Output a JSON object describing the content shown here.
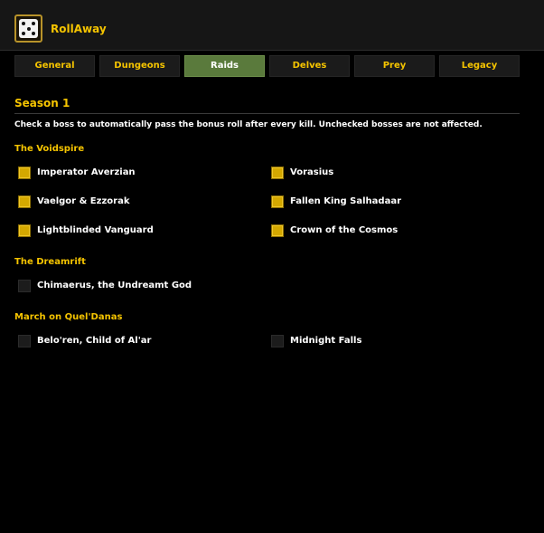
{
  "header": {
    "title": "RollAway",
    "logo_icon": "dice-five-icon"
  },
  "tabs": [
    {
      "label": "General",
      "active": false
    },
    {
      "label": "Dungeons",
      "active": false
    },
    {
      "label": "Raids",
      "active": true
    },
    {
      "label": "Delves",
      "active": false
    },
    {
      "label": "Prey",
      "active": false
    },
    {
      "label": "Legacy",
      "active": false
    }
  ],
  "season": {
    "title": "Season 1",
    "description": "Check a boss to automatically pass the bonus roll after every kill. Unchecked bosses are not affected."
  },
  "groups": [
    {
      "title": "The Voidspire",
      "bosses": [
        {
          "name": "Imperator Averzian",
          "checked": true
        },
        {
          "name": "Vorasius",
          "checked": true
        },
        {
          "name": "Vaelgor & Ezzorak",
          "checked": true
        },
        {
          "name": "Fallen King Salhadaar",
          "checked": true
        },
        {
          "name": "Lightblinded Vanguard",
          "checked": true
        },
        {
          "name": "Crown of the Cosmos",
          "checked": true
        }
      ]
    },
    {
      "title": "The Dreamrift",
      "bosses": [
        {
          "name": "Chimaerus, the Undreamt God",
          "checked": false
        }
      ]
    },
    {
      "title": "March on Quel'Danas",
      "bosses": [
        {
          "name": "Belo'ren, Child of Al'ar",
          "checked": false
        },
        {
          "name": "Midnight Falls",
          "checked": false
        }
      ]
    }
  ],
  "colors": {
    "accent": "#f5c400",
    "active_tab": "#5a7a3c",
    "checked_box": "#d4a800",
    "background": "#000000"
  }
}
